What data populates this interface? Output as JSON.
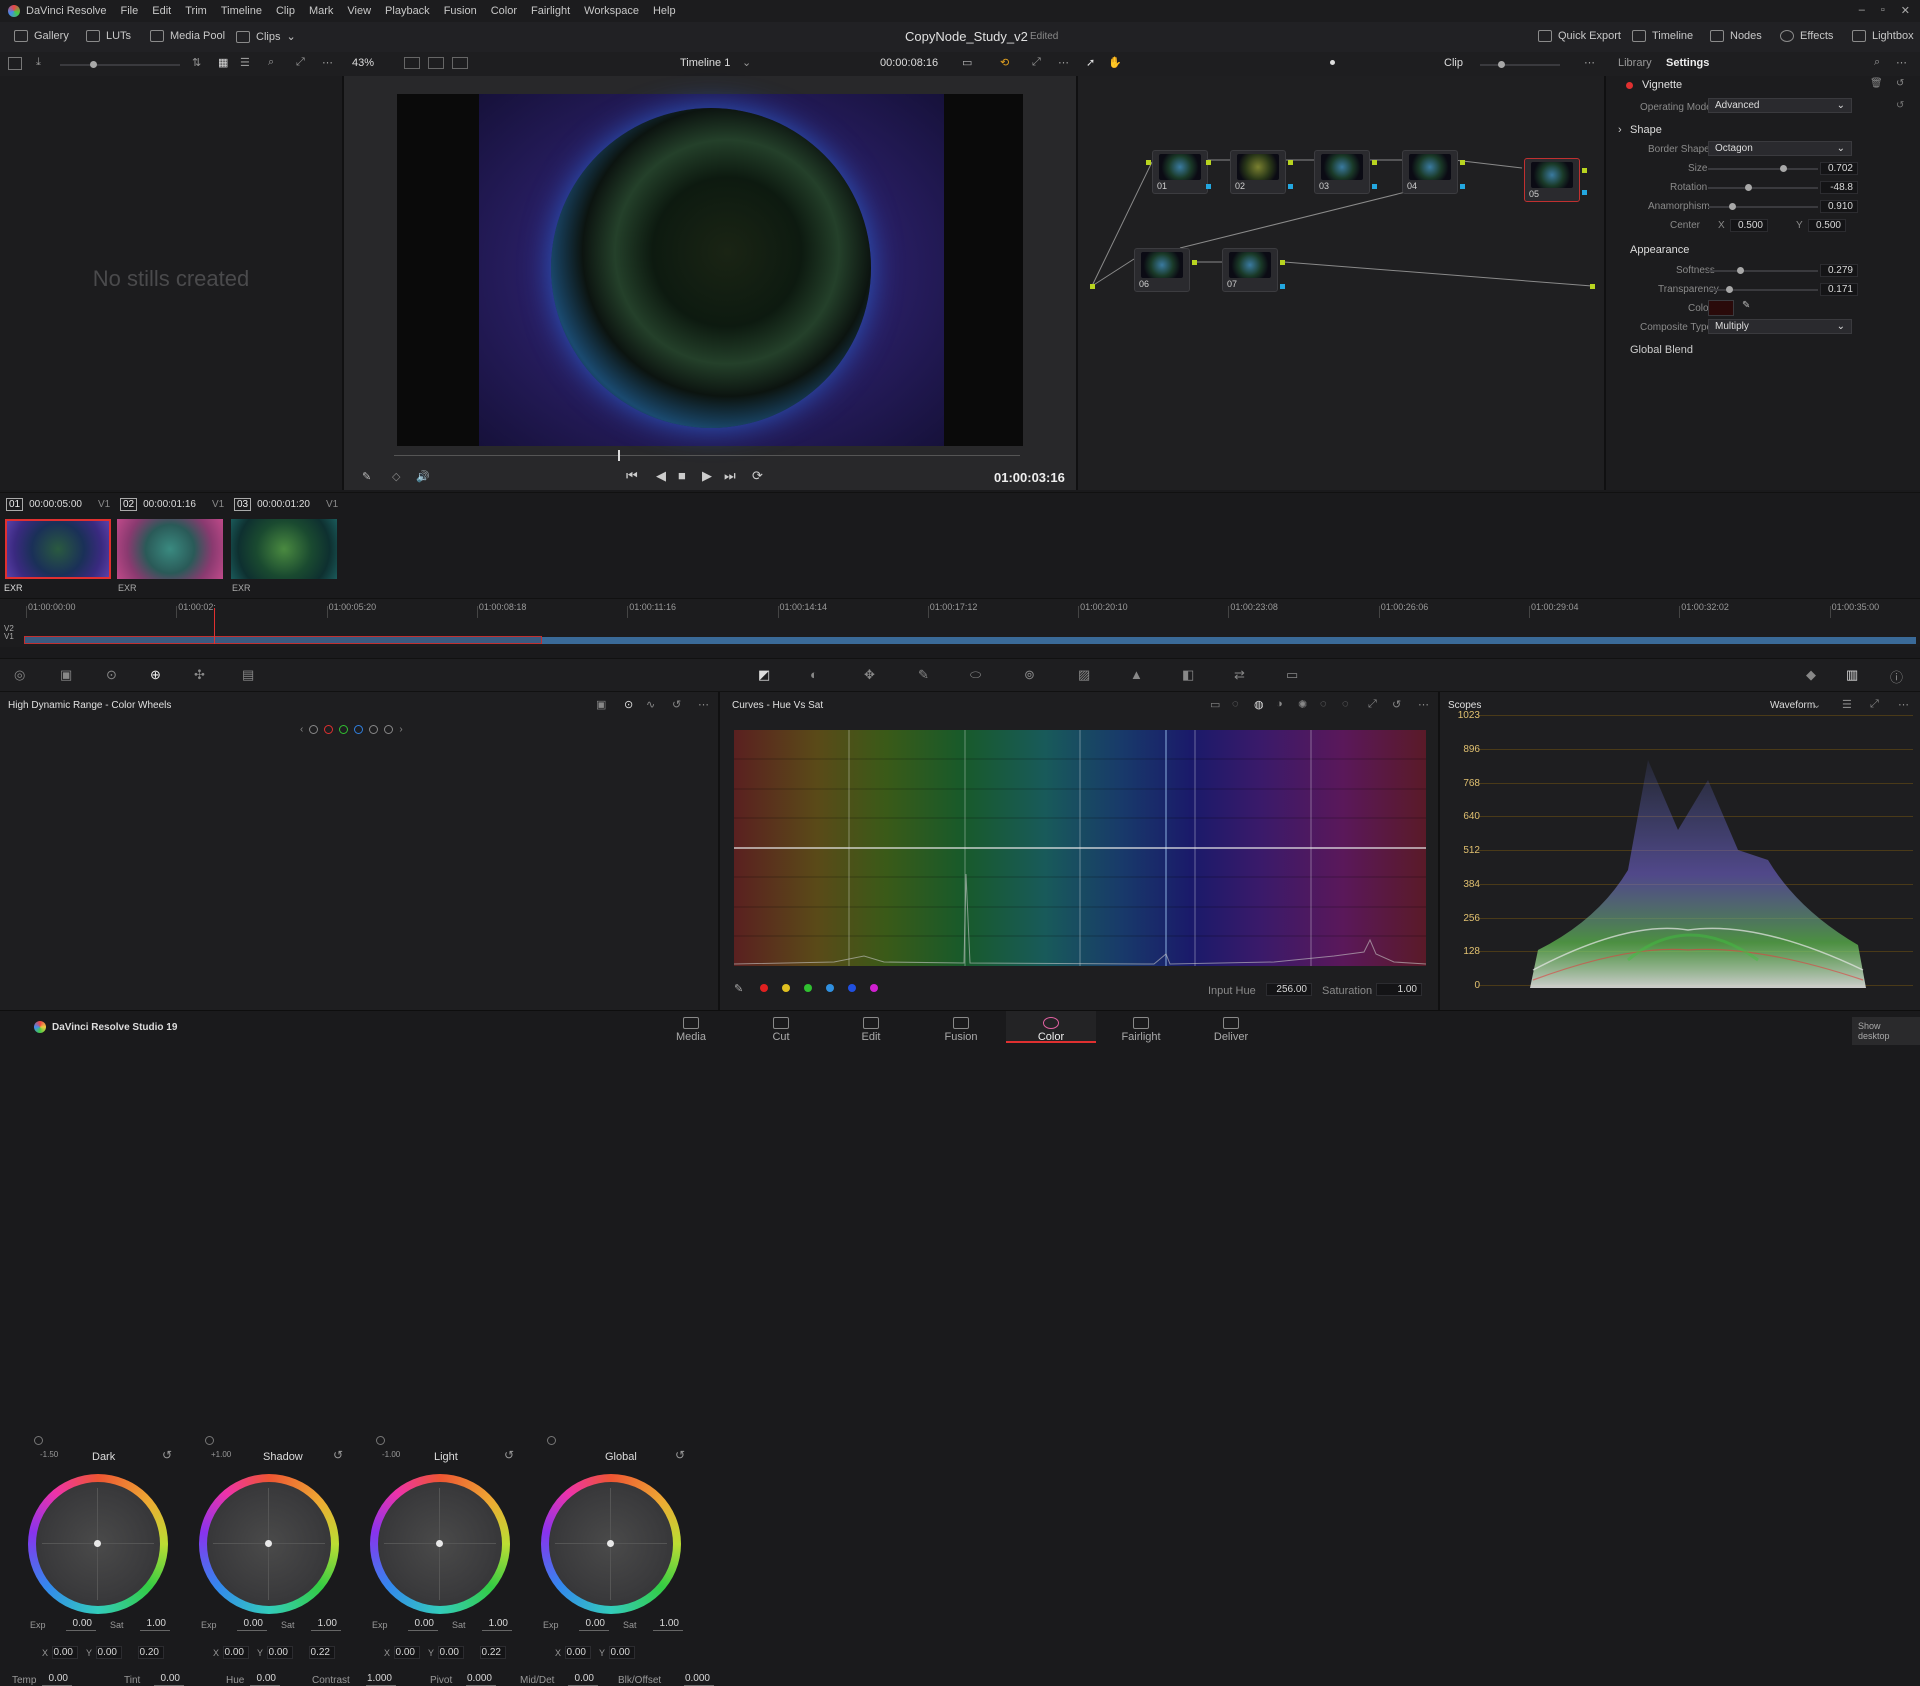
{
  "menubar": {
    "app_title": "DaVinci Resolve",
    "items": [
      "File",
      "Edit",
      "Trim",
      "Timeline",
      "Clip",
      "Mark",
      "View",
      "Playback",
      "Fusion",
      "Color",
      "Fairlight",
      "Workspace",
      "Help"
    ]
  },
  "toolbar": {
    "gallery": "Gallery",
    "luts": "LUTs",
    "media_pool": "Media Pool",
    "clips": "Clips",
    "project_title": "CopyNode_Study_v2",
    "project_status": "Edited",
    "quick_export": "Quick Export",
    "timeline": "Timeline",
    "nodes": "Nodes",
    "effects": "Effects",
    "lightbox": "Lightbox"
  },
  "viewer": {
    "zoom": "43%",
    "timeline_name": "Timeline 1",
    "source_timecode": "00:00:08:16",
    "current_timecode": "01:00:03:16",
    "clip_mode": "Clip"
  },
  "gallery_panel": {
    "empty_text": "No stills created"
  },
  "inspector": {
    "tabs": [
      "Library",
      "Settings"
    ],
    "effect_name": "Vignette",
    "operating_mode_label": "Operating Mode",
    "operating_mode": "Advanced",
    "shape_header": "Shape",
    "border_shape_label": "Border Shape",
    "border_shape": "Octagon",
    "size_label": "Size",
    "size": "0.702",
    "rotation_label": "Rotation",
    "rotation": "-48.8",
    "anamorphism_label": "Anamorphism",
    "anamorphism": "0.910",
    "center_label": "Center",
    "center_x_label": "X",
    "center_x": "0.500",
    "center_y_label": "Y",
    "center_y": "0.500",
    "appearance_header": "Appearance",
    "softness_label": "Softness",
    "softness": "0.279",
    "transparency_label": "Transparency",
    "transparency": "0.171",
    "color_label": "Color",
    "composite_label": "Composite Type",
    "composite": "Multiply",
    "global_blend": "Global Blend",
    "sliders": {
      "size": 0.702,
      "rotation": 0.36,
      "anamorphism": 0.2,
      "softness": 0.279,
      "transparency": 0.171
    }
  },
  "nodes": [
    "01",
    "02",
    "03",
    "04",
    "05",
    "06",
    "07"
  ],
  "clips": [
    {
      "num": "01",
      "tc": "00:00:05:00",
      "track": "V1",
      "fmt": "EXR"
    },
    {
      "num": "02",
      "tc": "00:00:01:16",
      "track": "V1",
      "fmt": "EXR"
    },
    {
      "num": "03",
      "tc": "00:00:01:20",
      "track": "V1",
      "fmt": "EXR"
    }
  ],
  "timeline_ruler": [
    "01:00:00:00",
    "01:00:02:",
    "01:00:05:20",
    "01:00:08:18",
    "01:00:11:16",
    "01:00:14:14",
    "01:00:17:12",
    "01:00:20:10",
    "01:00:23:08",
    "01:00:26:06",
    "01:00:29:04",
    "01:00:32:02",
    "01:00:35:00"
  ],
  "tracks": [
    "V2",
    "V1"
  ],
  "color_wheels": {
    "title": "High Dynamic Range - Color Wheels",
    "wheels": [
      {
        "name": "Dark",
        "zone": "-1.50",
        "exp": "0.00",
        "sat": "1.00",
        "x": "0.00",
        "y": "0.00",
        "z": "0.20"
      },
      {
        "name": "Shadow",
        "zone": "+1.00",
        "exp": "0.00",
        "sat": "1.00",
        "x": "0.00",
        "y": "0.00",
        "z": "0.22"
      },
      {
        "name": "Light",
        "zone": "-1.00",
        "exp": "0.00",
        "sat": "1.00",
        "x": "0.00",
        "y": "0.00",
        "z": "0.22"
      },
      {
        "name": "Global",
        "zone": "",
        "exp": "0.00",
        "sat": "1.00",
        "x": "0.00",
        "y": "0.00",
        "z": ""
      }
    ],
    "labels": {
      "exp": "Exp",
      "sat": "Sat",
      "x": "X",
      "y": "Y"
    },
    "bottom": [
      {
        "label": "Temp",
        "value": "0.00"
      },
      {
        "label": "Tint",
        "value": "0.00"
      },
      {
        "label": "Hue",
        "value": "0.00"
      },
      {
        "label": "Contrast",
        "value": "1.000"
      },
      {
        "label": "Pivot",
        "value": "0.000"
      },
      {
        "label": "Mid/Det",
        "value": "0.00"
      },
      {
        "label": "Blk/Offset",
        "value": "0.000"
      }
    ]
  },
  "curves": {
    "title": "Curves - Hue Vs Sat",
    "input_hue_label": "Input Hue",
    "input_hue": "256.00",
    "saturation_label": "Saturation",
    "saturation": "1.00"
  },
  "scopes": {
    "title": "Scopes",
    "mode": "Waveform",
    "scale": [
      "1023",
      "896",
      "768",
      "640",
      "512",
      "384",
      "256",
      "128",
      "0"
    ]
  },
  "pages": [
    "Media",
    "Cut",
    "Edit",
    "Fusion",
    "Color",
    "Fairlight",
    "Deliver"
  ],
  "footer": {
    "brand": "DaVinci Resolve Studio 19",
    "show_desktop": "Show desktop"
  }
}
